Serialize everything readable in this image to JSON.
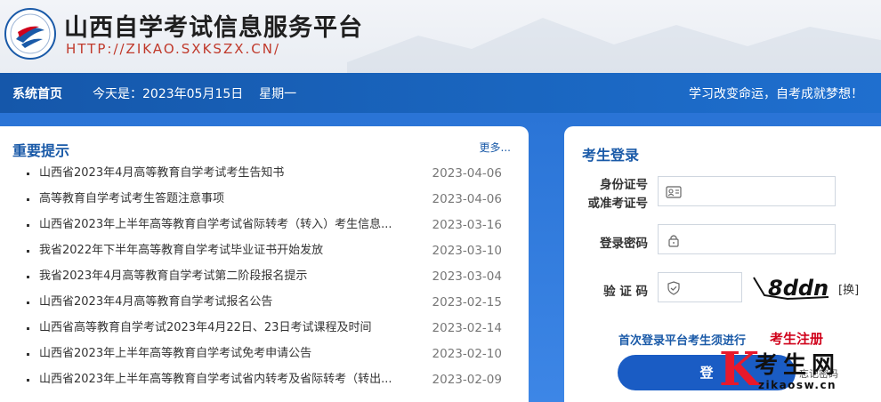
{
  "header": {
    "title": "山西自学考试信息服务平台",
    "url": "HTTP://ZIKAO.SXKSZX.CN/"
  },
  "nav": {
    "home": "系统首页",
    "today_label": "今天是：2023年05月15日",
    "weekday": "星期一",
    "slogan": "学习改变命运，自考成就梦想！"
  },
  "notice": {
    "title": "重要提示",
    "more": "更多...",
    "items": [
      {
        "text": "山西省2023年4月高等教育自学考试考生告知书",
        "date": "2023-04-06"
      },
      {
        "text": "高等教育自学考试考生答题注意事项",
        "date": "2023-04-06"
      },
      {
        "text": "山西省2023年上半年高等教育自学考试省际转考（转入）考生信息...",
        "date": "2023-03-16"
      },
      {
        "text": "我省2022年下半年高等教育自学考试毕业证书开始发放",
        "date": "2023-03-10"
      },
      {
        "text": "我省2023年4月高等教育自学考试第二阶段报名提示",
        "date": "2023-03-04"
      },
      {
        "text": "山西省2023年4月高等教育自学考试报名公告",
        "date": "2023-02-15"
      },
      {
        "text": "山西省高等教育自学考试2023年4月22日、23日考试课程及时间",
        "date": "2023-02-14"
      },
      {
        "text": "山西省2023年上半年高等教育自学考试免考申请公告",
        "date": "2023-02-10"
      },
      {
        "text": "山西省2023年上半年高等教育自学考试省内转考及省际转考（转出...",
        "date": "2023-02-09"
      }
    ]
  },
  "login": {
    "title": "考生登录",
    "id_label_line1": "身份证号",
    "id_label_line2": "或准考证号",
    "password_label": "登录密码",
    "captcha_label": "验 证 码",
    "captcha_text": "8ddn",
    "swap": "[换]",
    "register_tip": "首次登录平台考生须进行",
    "register_link": "考生注册",
    "login_button": "登",
    "forgot": "忘记密码"
  },
  "watermark": {
    "letter": "K",
    "name": "考生网",
    "url": "zikaosw.cn"
  },
  "colors": {
    "nav_blue": "#1a66c0",
    "title_blue": "#1a5aa8",
    "register_red": "#d0021b",
    "url_red": "#c0392b"
  }
}
